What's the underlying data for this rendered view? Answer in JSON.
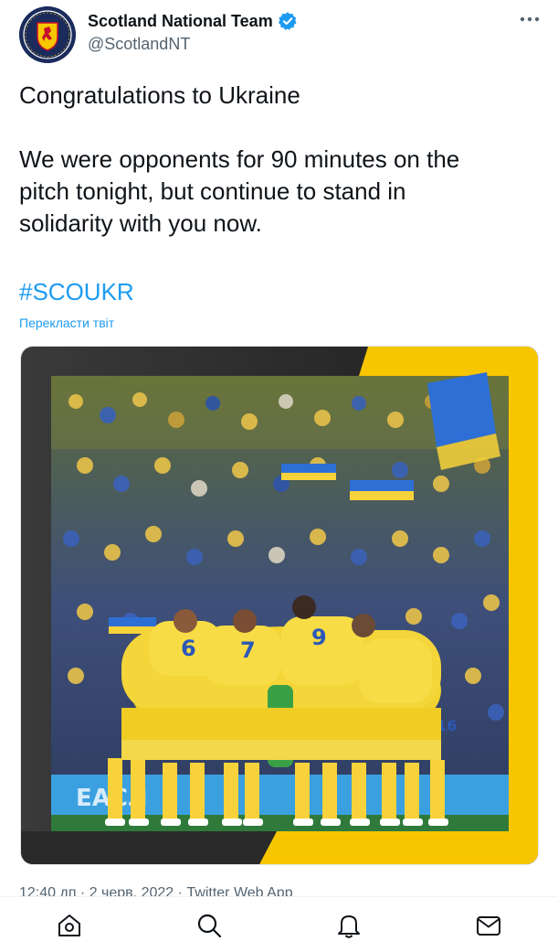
{
  "account": {
    "display_name": "Scotland National Team",
    "handle": "@ScotlandNT",
    "verified": true,
    "avatar_text_top": "SCOTLAND",
    "avatar_text_bottom": "EST 1873"
  },
  "tweet": {
    "line1": "Congratulations to Ukraine",
    "line2": "We were opponents for 90 minutes on the",
    "line3": "pitch tonight, but continue to stand in",
    "line4": "solidarity with you now.",
    "hashtag": "#SCOUKR",
    "translate_label": "Перекласти твіт",
    "meta": "12:40 дп · 2 черв. 2022 · Twitter Web App"
  },
  "media": {
    "frame_colors": [
      "#2b2b2b",
      "#f7c600"
    ],
    "pitch_board_text": "ЕАСЛ"
  },
  "colors": {
    "accent": "#1d9bf0",
    "text": "#0f1419",
    "secondary": "#536471",
    "ukraine_blue": "#1e6fd6",
    "ukraine_yellow": "#f7c600"
  },
  "nav": {
    "items": [
      "home-icon",
      "search-icon",
      "notifications-icon",
      "messages-icon"
    ]
  }
}
